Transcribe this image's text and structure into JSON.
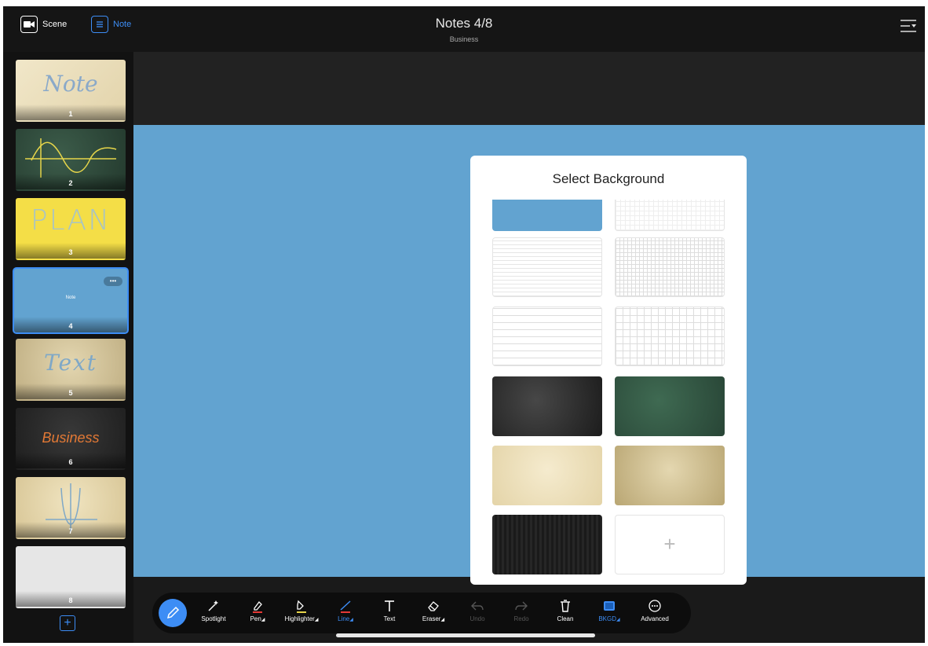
{
  "topbar": {
    "scene_label": "Scene",
    "note_label": "Note",
    "title": "Notes 4/8",
    "subtitle": "Business"
  },
  "sidebar": {
    "pages": [
      {
        "num": "1",
        "text": "Note",
        "bg": "#eadfbd",
        "text_color": "#8aa9c9"
      },
      {
        "num": "2",
        "text": "",
        "bg": "#2e4a3b",
        "text_color": "#e6d54a"
      },
      {
        "num": "3",
        "text": "PLAN",
        "bg": "#f4de47",
        "text_color": "#a9c4c3"
      },
      {
        "num": "4",
        "text": "Note",
        "bg": "#62a3d0",
        "text_color": "#ffffff",
        "more": "•••"
      },
      {
        "num": "5",
        "text": "Text",
        "bg": "#d9cba4",
        "text_color": "#7fa8c7"
      },
      {
        "num": "6",
        "text": "Business",
        "bg": "#2a2a2a",
        "text_color": "#e37935"
      },
      {
        "num": "7",
        "text": "",
        "bg": "#e6d8b2",
        "text_color": "#7fa8c7"
      },
      {
        "num": "8",
        "text": "",
        "bg": "#e8e8e8",
        "text_color": "#888"
      }
    ],
    "add_label": "+"
  },
  "dialog": {
    "title": "Select Background",
    "add_label": "+"
  },
  "toolbar": {
    "spotlight": "Spotlight",
    "pen": "Pen",
    "highlighter": "Highlighter",
    "line": "Line",
    "text": "Text",
    "eraser": "Eraser",
    "undo": "Undo",
    "redo": "Redo",
    "clean": "Clean",
    "bkgd": "BKGD",
    "advanced": "Advanced"
  },
  "colors": {
    "accent": "#3d8df5",
    "canvas": "#62a3d0"
  }
}
